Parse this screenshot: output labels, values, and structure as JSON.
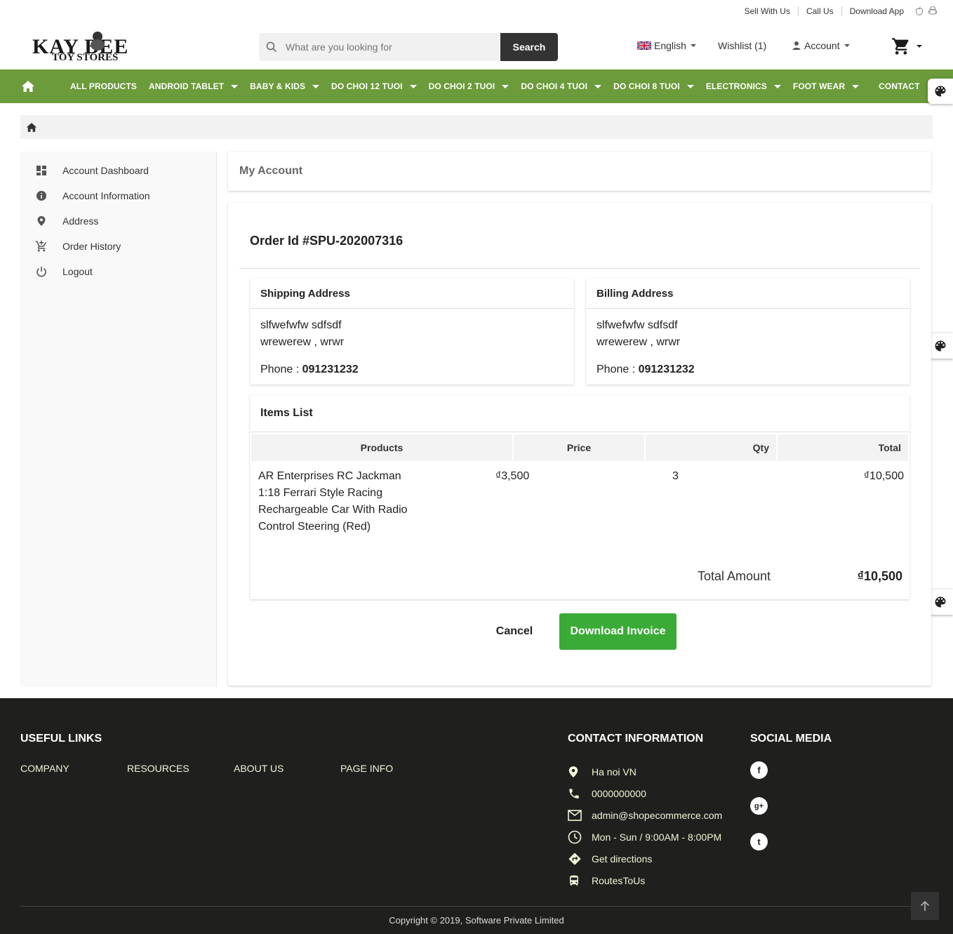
{
  "topbar": {
    "sell": "Sell With Us",
    "call": "Call Us",
    "download": "Download App"
  },
  "logo": {
    "line1": "KAY BEE",
    "line2": "TOY STORES"
  },
  "search": {
    "placeholder": "What are you looking for",
    "button": "Search"
  },
  "header": {
    "language": "English",
    "wishlist": "Wishlist (1)",
    "account": "Account"
  },
  "nav": {
    "items": [
      {
        "label": "ALL PRODUCTS",
        "dropdown": false
      },
      {
        "label": "ANDROID TABLET",
        "dropdown": true
      },
      {
        "label": "BABY & KIDS",
        "dropdown": true
      },
      {
        "label": "DO CHOI 12 TUOI",
        "dropdown": true
      },
      {
        "label": "DO CHOI 2 TUOI",
        "dropdown": true
      },
      {
        "label": "DO CHOI 4 TUOI",
        "dropdown": true
      },
      {
        "label": "DO CHOI 8 TUOI",
        "dropdown": true
      },
      {
        "label": "ELECTRONICS",
        "dropdown": true
      },
      {
        "label": "FOOT WEAR",
        "dropdown": true
      },
      {
        "label": "CONTACT",
        "dropdown": false
      }
    ]
  },
  "sidebar": {
    "items": [
      {
        "label": "Account Dashboard",
        "icon": "dashboard-icon"
      },
      {
        "label": "Account Information",
        "icon": "info-icon"
      },
      {
        "label": "Address",
        "icon": "location-pin-icon"
      },
      {
        "label": "Order History",
        "icon": "cart-icon"
      },
      {
        "label": "Logout",
        "icon": "power-icon"
      }
    ]
  },
  "main": {
    "title": "My Account",
    "order_id": "Order Id #SPU-202007316",
    "shipping": {
      "title": "Shipping Address",
      "name": "slfwefwfw sdfsdf",
      "address": "wrewerew , wrwr",
      "phone_label": "Phone : ",
      "phone": "091231232"
    },
    "billing": {
      "title": "Billing Address",
      "name": "slfwefwfw sdfsdf",
      "address": "wrewerew , wrwr",
      "phone_label": "Phone : ",
      "phone": "091231232"
    },
    "items": {
      "title": "Items List",
      "headers": {
        "products": "Products",
        "price": "Price",
        "qty": "Qty",
        "total": "Total"
      },
      "rows": [
        {
          "product": "AR Enterprises RC Jackman 1:18 Ferrari Style Racing Rechargeable Car With Radio Control Steering (Red)",
          "price": "₫3,500",
          "qty": "3",
          "total": "₫10,500"
        }
      ],
      "total_label": "Total Amount",
      "total_value": "₫10,500"
    },
    "cancel": "Cancel",
    "download": "Download Invoice"
  },
  "footer": {
    "useful_links_title": "USEFUL LINKS",
    "links": [
      "COMPANY",
      "RESOURCES",
      "ABOUT US",
      "PAGE INFO"
    ],
    "contact_title": "CONTACT INFORMATION",
    "contact": [
      {
        "text": "Ha noi VN",
        "icon": "location-pin-icon"
      },
      {
        "text": "0000000000",
        "icon": "phone-icon"
      },
      {
        "text": "admin@shopecommerce.com",
        "icon": "mail-icon"
      },
      {
        "text": "Mon - Sun / 9:00AM - 8:00PM",
        "icon": "clock-icon"
      },
      {
        "text": "Get directions",
        "icon": "directions-icon"
      },
      {
        "text": "RoutesToUs",
        "icon": "bus-icon"
      }
    ],
    "social_title": "SOCIAL MEDIA",
    "social": [
      {
        "glyph": "f",
        "icon": "facebook-icon"
      },
      {
        "glyph": "g+",
        "icon": "google-plus-icon"
      },
      {
        "glyph": "t",
        "icon": "twitter-icon"
      }
    ],
    "copyright": "Copyright © 2019, Software Private Limited"
  },
  "colors": {
    "nav_green": "#6b9b3a",
    "button_green": "#3aab36",
    "footer_bg": "#1f1f1d"
  }
}
